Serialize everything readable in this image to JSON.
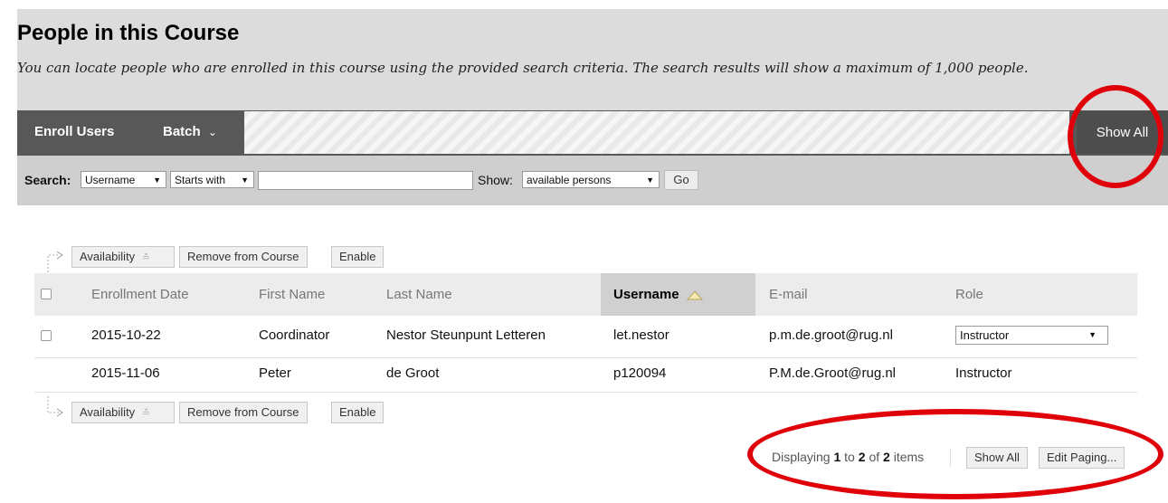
{
  "page": {
    "title": "People in this Course",
    "description": "You can locate people who are enrolled in this course using the provided search criteria. The search results will show a maximum of 1,000 people."
  },
  "action_bar": {
    "enroll_users": "Enroll Users",
    "batch": "Batch",
    "show_all": "Show All"
  },
  "search": {
    "label": "Search:",
    "field_value": "Username",
    "operator_value": "Starts with",
    "query_value": "",
    "show_label": "Show:",
    "show_value": "available persons",
    "go": "Go"
  },
  "bulk_actions": {
    "availability": "Availability",
    "remove": "Remove from Course",
    "enable": "Enable"
  },
  "table": {
    "columns": [
      "Enrollment Date",
      "First Name",
      "Last Name",
      "Username",
      "E-mail",
      "Role"
    ],
    "sorted_column": "Username",
    "rows": [
      {
        "date": "2015-10-22",
        "first": "Coordinator",
        "last": "Nestor Steunpunt Letteren",
        "username": "let.nestor",
        "email": "p.m.de.groot@rug.nl",
        "role": "Instructor"
      },
      {
        "date": "2015-11-06",
        "first": "Peter",
        "last": "de Groot",
        "username": "p120094",
        "email": "P.M.de.Groot@rug.nl",
        "role": "Instructor"
      }
    ]
  },
  "paging": {
    "prefix": "Displaying",
    "from": "1",
    "to_word": "to",
    "to": "2",
    "of_word": "of",
    "total": "2",
    "suffix": "items",
    "show_all": "Show All",
    "edit_paging": "Edit Paging..."
  },
  "colors": {
    "highlight_ring": "#e0000a",
    "action_bar": "#585858",
    "header_bg": "#dcdcdc"
  }
}
